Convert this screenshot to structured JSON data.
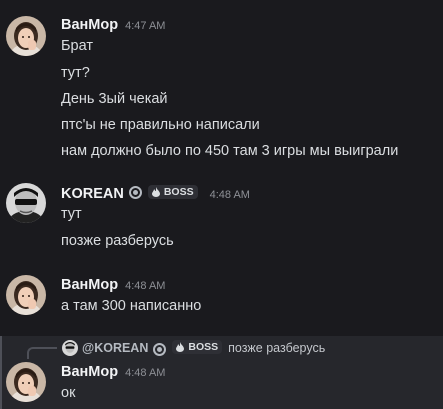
{
  "messages": [
    {
      "username": "ВанМор",
      "timestamp": "4:47 AM",
      "lines": [
        "Брат",
        "тут?",
        "День 3ый чекай",
        "птс'ы не правильно написали",
        "нам должно было по 450 там 3 игры мы выиграли"
      ]
    },
    {
      "username": "KOREAN",
      "timestamp": "4:48 AM",
      "tag": "BOSS",
      "lines": [
        "тут",
        "позже разберусь"
      ]
    },
    {
      "username": "ВанМор",
      "timestamp": "4:48 AM",
      "lines": [
        "а там 300 написанно"
      ]
    },
    {
      "reply": {
        "mention": "@KOREAN",
        "tag": "BOSS",
        "text": "позже разберусь"
      },
      "username": "ВанМор",
      "timestamp": "4:48 AM",
      "lines": [
        "ок"
      ]
    }
  ],
  "colors": {
    "background": "#1a1a1e",
    "reply_highlight": "#26272c",
    "username": "#f2f3f5",
    "message_text": "#dbdee1",
    "timestamp": "#8e9096"
  },
  "icons": {
    "verified": "verified-badge-icon",
    "tag": "flame-icon",
    "reply": "reply-arrow-icon"
  }
}
